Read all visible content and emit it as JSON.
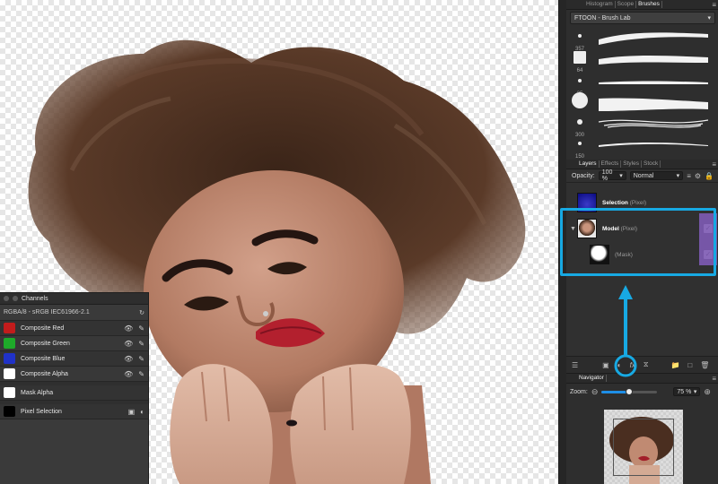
{
  "colors": {
    "accent_highlight": "#17a9e3",
    "purple_mask": "#7e5bb5",
    "panel_bg": "#303030"
  },
  "channels": {
    "title": "Channels",
    "format": "RGBA/8 - sRGB IEC61966-2.1",
    "rows": [
      {
        "name": "Composite Red",
        "swatch": "#c21c1c"
      },
      {
        "name": "Composite Green",
        "swatch": "#1eaa2a"
      },
      {
        "name": "Composite Blue",
        "swatch": "#2032c8"
      },
      {
        "name": "Composite Alpha",
        "swatch": "#ffffff"
      }
    ],
    "mask_alpha": "Mask Alpha",
    "pixel_selection": "Pixel Selection"
  },
  "top_tabs": [
    {
      "label": "Histogram",
      "active": false
    },
    {
      "label": "Scope",
      "active": false
    },
    {
      "label": "Brushes",
      "active": true
    }
  ],
  "brushes": {
    "preset": "FTOON - Brush Lab",
    "sizes": [
      "357",
      "64",
      "25",
      "",
      "300",
      "150"
    ]
  },
  "layers_panel": {
    "tabs": [
      {
        "label": "Layers",
        "active": true
      },
      {
        "label": "Effects",
        "active": false
      },
      {
        "label": "Styles",
        "active": false
      },
      {
        "label": "Stock",
        "active": false
      }
    ],
    "opacity_label": "Opacity:",
    "opacity_value": "100 %",
    "blend_mode": "Normal",
    "layers": [
      {
        "name": "Selection",
        "type": "(Pixel)"
      },
      {
        "name": "Model",
        "type": "(Pixel)"
      },
      {
        "name": "",
        "type": "(Mask)"
      }
    ]
  },
  "navigator": {
    "title": "Navigator",
    "zoom_label": "Zoom:",
    "zoom_value": "75 %",
    "zoom_fraction": 0.5
  }
}
